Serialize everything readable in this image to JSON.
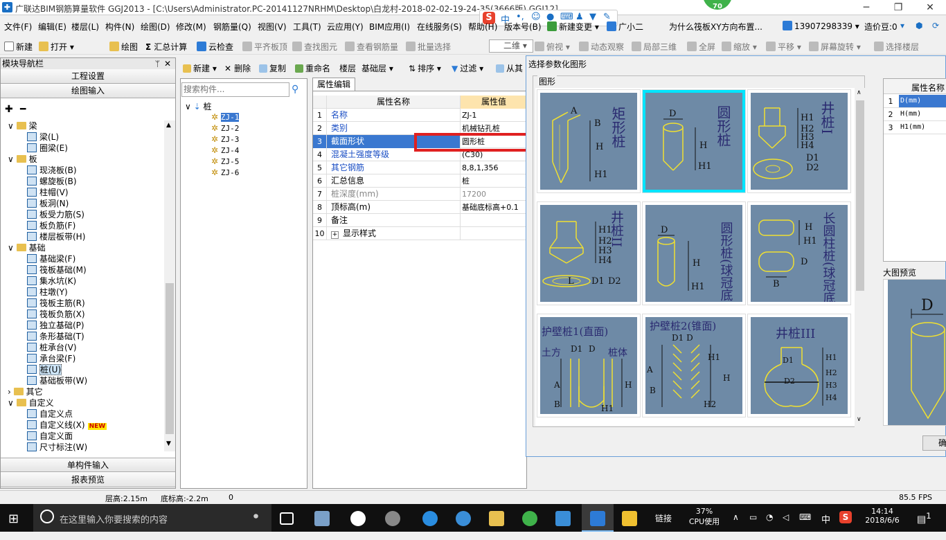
{
  "window": {
    "title": "广联达BIM钢筋算量软件 GGJ2013 - [C:\\Users\\Administrator.PC-20141127NRHM\\Desktop\\白龙村-2018-02-02-19-24-35(3666版).GGJ12]",
    "badge": "70",
    "min": "─",
    "max": "❐",
    "close": "✕"
  },
  "menu": [
    "文件(F)",
    "编辑(E)",
    "楼层(L)",
    "构件(N)",
    "绘图(D)",
    "修改(M)",
    "钢筋量(Q)",
    "视图(V)",
    "工具(T)",
    "云应用(Y)",
    "BIM应用(I)",
    "在线服务(S)",
    "帮助(H)",
    "版本号(B)",
    "新建变更",
    "广小二"
  ],
  "menu_right": {
    "question": "为什么筏板XY方向布置...",
    "phone": "13907298339",
    "beans": "造价豆:0"
  },
  "toolbar": [
    "新建",
    "打开",
    "绘图",
    "汇总计算",
    "云检查",
    "平齐板顶",
    "查找图元",
    "查看钢筋量",
    "批量选择",
    "二维",
    "俯视",
    "动态观察",
    "局部三维",
    "全屏",
    "缩放",
    "平移",
    "屏幕旋转",
    "选择楼层"
  ],
  "nav": {
    "title": "模块导航栏",
    "pin": "ᛘ",
    "close": "✕",
    "btn_project": "工程设置",
    "btn_draw": "绘图输入",
    "btn_single": "单构件输入",
    "btn_report": "报表预览",
    "tree": [
      {
        "label": "梁",
        "level": 0,
        "folder": true
      },
      {
        "label": "梁(L)",
        "level": 1
      },
      {
        "label": "圈梁(E)",
        "level": 1
      },
      {
        "label": "板",
        "level": 0,
        "folder": true
      },
      {
        "label": "现浇板(B)",
        "level": 1
      },
      {
        "label": "螺旋板(B)",
        "level": 1
      },
      {
        "label": "柱帽(V)",
        "level": 1
      },
      {
        "label": "板洞(N)",
        "level": 1
      },
      {
        "label": "板受力筋(S)",
        "level": 1
      },
      {
        "label": "板负筋(F)",
        "level": 1
      },
      {
        "label": "楼层板带(H)",
        "level": 1
      },
      {
        "label": "基础",
        "level": 0,
        "folder": true
      },
      {
        "label": "基础梁(F)",
        "level": 1
      },
      {
        "label": "筏板基础(M)",
        "level": 1
      },
      {
        "label": "集水坑(K)",
        "level": 1
      },
      {
        "label": "柱墩(Y)",
        "level": 1
      },
      {
        "label": "筏板主筋(R)",
        "level": 1
      },
      {
        "label": "筏板负筋(X)",
        "level": 1
      },
      {
        "label": "独立基础(P)",
        "level": 1
      },
      {
        "label": "条形基础(T)",
        "level": 1
      },
      {
        "label": "桩承台(V)",
        "level": 1
      },
      {
        "label": "承台梁(F)",
        "level": 1
      },
      {
        "label": "桩(U)",
        "level": 1,
        "selected": true
      },
      {
        "label": "基础板带(W)",
        "level": 1
      },
      {
        "label": "其它",
        "level": 0,
        "folder": true,
        "collapsed": true
      },
      {
        "label": "自定义",
        "level": 0,
        "folder": true
      },
      {
        "label": "自定义点",
        "level": 1
      },
      {
        "label": "自定义线(X)",
        "level": 1,
        "new": "NEW"
      },
      {
        "label": "自定义面",
        "level": 1
      },
      {
        "label": "尺寸标注(W)",
        "level": 1
      }
    ]
  },
  "comp_toolbar": {
    "new": "新建",
    "delete": "删除",
    "copy": "复制",
    "rename": "重命名",
    "floor": "楼层",
    "floor_value": "基础层",
    "sort": "排序",
    "filter": "过滤",
    "from": "从其"
  },
  "comp": {
    "search_placeholder": "搜索构件...",
    "root": "桩",
    "items": [
      "ZJ-1",
      "ZJ-2",
      "ZJ-3",
      "ZJ-4",
      "ZJ-5",
      "ZJ-6"
    ]
  },
  "props": {
    "tab": "属性编辑",
    "col_name": "属性名称",
    "col_value": "属性值",
    "rows": [
      {
        "n": "1",
        "name": "名称",
        "value": "ZJ-1",
        "blue": true
      },
      {
        "n": "2",
        "name": "类别",
        "value": "机械钻孔桩",
        "blue": true
      },
      {
        "n": "3",
        "name": "截面形状",
        "value": "圆形桩",
        "blue": true,
        "selected": true
      },
      {
        "n": "4",
        "name": "混凝土强度等级",
        "value": "(C30)",
        "blue": true
      },
      {
        "n": "5",
        "name": "其它钢筋",
        "value": "8,8,1,356",
        "blue": true
      },
      {
        "n": "6",
        "name": "汇总信息",
        "value": "桩"
      },
      {
        "n": "7",
        "name": "桩深度(mm)",
        "value": "17200",
        "gray": true
      },
      {
        "n": "8",
        "name": "顶标高(m)",
        "value": "基础底标高+0.1"
      },
      {
        "n": "9",
        "name": "备注",
        "value": ""
      },
      {
        "n": "10",
        "name": "显示样式",
        "value": "",
        "expand": "+"
      }
    ]
  },
  "dialog": {
    "title": "选择参数化图形",
    "group": "图形",
    "shapes": [
      "矩形桩",
      "圆形桩",
      "井桩I",
      "井桩II",
      "圆形桩(球冠底)",
      "长圆柱桩(球冠底)",
      "护壁桩1(直面)",
      "护壁桩2(锥面)",
      "井桩III"
    ],
    "params_header": "属性名称",
    "params": [
      {
        "n": "1",
        "name": "D(mm)",
        "selected": true
      },
      {
        "n": "2",
        "name": "H(mm)"
      },
      {
        "n": "3",
        "name": "H1(mm)"
      }
    ],
    "preview_label": "大图预览",
    "preview_dim": "D",
    "ok": "确"
  },
  "shape_labels": {
    "a": "A",
    "b": "B",
    "h": "H",
    "h1": "H1",
    "h2": "H2",
    "h3": "H3",
    "h4": "H4",
    "d": "D",
    "d1": "D1",
    "d2": "D2",
    "l": "L",
    "earth": "土方",
    "body": "桩体",
    "d1d": "D1 D"
  },
  "status": {
    "floor_h": "层高:2.15m",
    "bottom_h": "底标高:-2.2m",
    "zero": "0",
    "fps": "85.5 FPS"
  },
  "taskbar": {
    "search": "在这里输入你要搜索的内容",
    "link": "链接",
    "cpu_pct": "37%",
    "cpu_label": "CPU使用",
    "ime": "中",
    "time": "14:14",
    "date": "2018/6/6",
    "notif": "1"
  }
}
